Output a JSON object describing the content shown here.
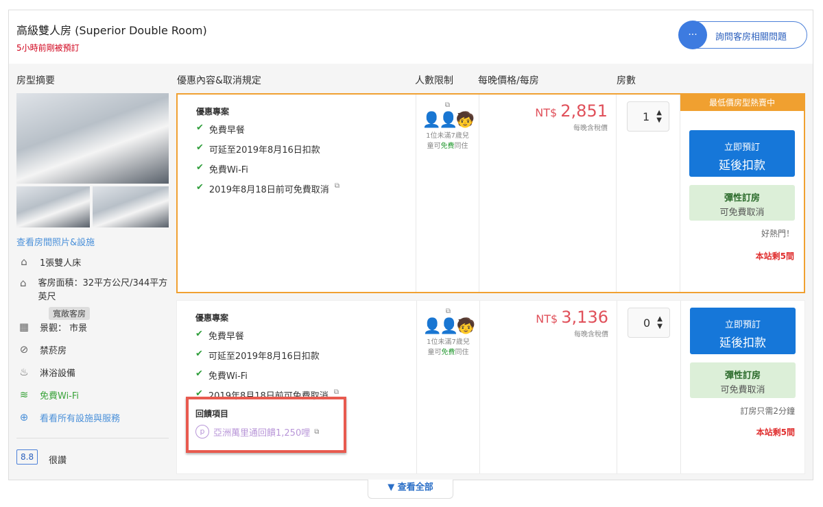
{
  "room": {
    "title": "高級雙人房 (Superior Double Room)",
    "booked_note": "5小時前剛被預訂",
    "ask_label": "詢問客房相關問題"
  },
  "columns": [
    "房型摘要",
    "優惠內容&取消規定",
    "人數限制",
    "每晚價格/每房",
    "房數"
  ],
  "left": {
    "photos_link": "查看房間照片&設施",
    "bed": "1張雙人床",
    "area": "客房面積：32平方公尺/344平方英尺",
    "spacious_tag": "寬敞客房",
    "view": "景觀： 市景",
    "nonsmoking": "禁菸房",
    "shower": "淋浴設備",
    "wifi": "免費Wi-Fi",
    "all_facilities": "看看所有設施與服務",
    "score": "8.8",
    "score_label": "很讚"
  },
  "offers": [
    {
      "heading": "優惠專案",
      "items": [
        "免費早餐",
        "可延至2019年8月16日扣款",
        "免費Wi-Fi",
        "2019年8月18日前可免費取消"
      ],
      "child_a": "1位未滿7歲兒",
      "child_b": "童可",
      "child_free": "免費",
      "child_c": "同住",
      "currency": "NT$",
      "price": "2,851",
      "tax_note": "每晚含稅價",
      "rooms": "1",
      "banner": "最低價房型熱賣中",
      "book_a": "立即預訂",
      "book_b": "延後扣款",
      "flex_a": "彈性訂房",
      "flex_b": "可免費取消",
      "note": "好熱門！",
      "remaining": "本站剩5間"
    },
    {
      "heading": "優惠專案",
      "items": [
        "免費早餐",
        "可延至2019年8月16日扣款",
        "免費Wi-Fi",
        "2019年8月18日前可免費取消"
      ],
      "child_a": "1位未滿7歲兒",
      "child_b": "童可",
      "child_free": "免費",
      "child_c": "同住",
      "currency": "NT$",
      "price": "3,136",
      "tax_note": "每晚含稅價",
      "rooms": "0",
      "reward_heading": "回饋項目",
      "reward": "亞洲萬里通回饋1,250哩",
      "book_a": "立即預訂",
      "book_b": "延後扣款",
      "flex_a": "彈性訂房",
      "flex_b": "可免費取消",
      "note": "訂房只需2分鐘",
      "remaining": "本站剩5間"
    }
  ],
  "view_all": "查看全部"
}
